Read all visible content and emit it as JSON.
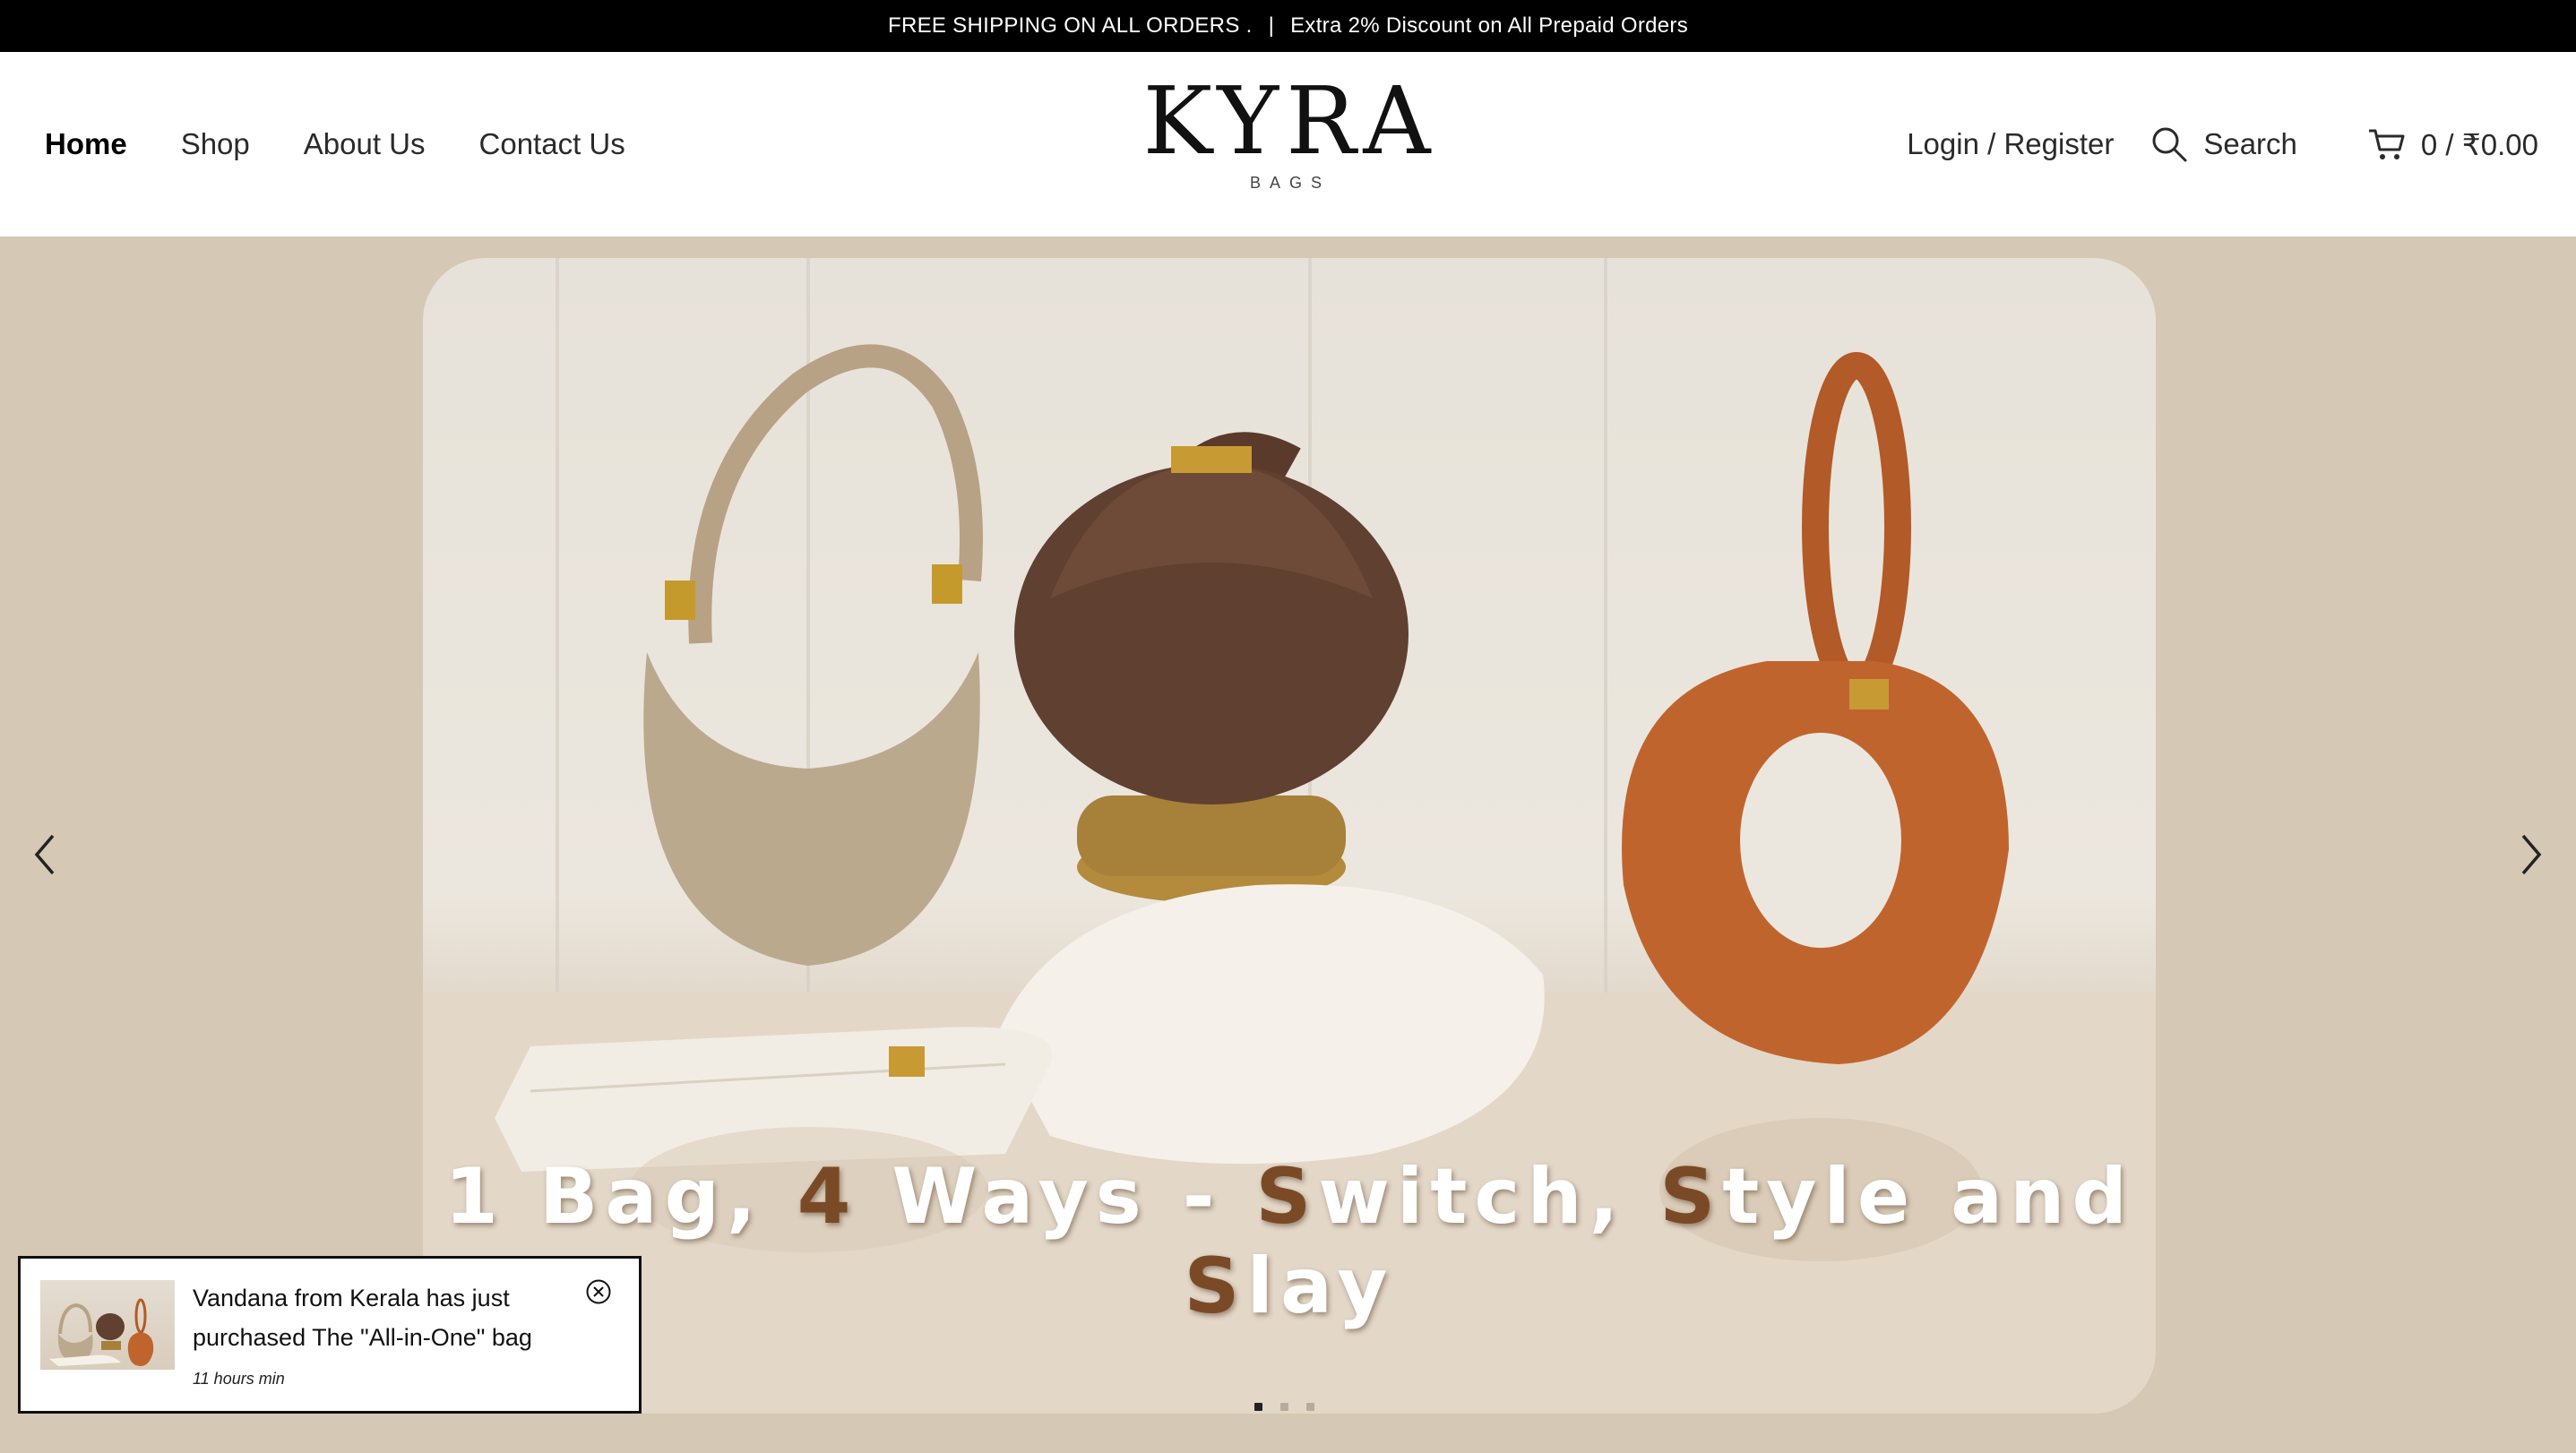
{
  "announcement": {
    "left": "FREE SHIPPING ON ALL ORDERS .",
    "separator": "|",
    "right": "Extra 2% Discount on All Prepaid Orders"
  },
  "nav": {
    "items": [
      {
        "label": "Home",
        "active": true
      },
      {
        "label": "Shop"
      },
      {
        "label": "About Us"
      },
      {
        "label": "Contact Us"
      }
    ]
  },
  "logo": {
    "word": "KYRA",
    "sub": "BAGS"
  },
  "header": {
    "login_label": "Login / Register",
    "search_label": "Search",
    "cart_label": "0 / ₹0.00"
  },
  "hero": {
    "caption_parts": [
      "1 Bag, ",
      "4",
      " Ways - ",
      "S",
      "witch, ",
      "S",
      "tyle and ",
      "S",
      "lay"
    ],
    "slide_count": 3,
    "active_slide": 1,
    "background_color": "#d5c8b4"
  },
  "popup": {
    "message": "Vandana from Kerala has just purchased The \"All-in-One\" bag",
    "time": "11 hours min"
  },
  "icons": {
    "prev": "chevron-left-icon",
    "next": "chevron-right-icon",
    "search": "search-icon",
    "cart": "cart-icon",
    "close": "close-circle-icon"
  }
}
